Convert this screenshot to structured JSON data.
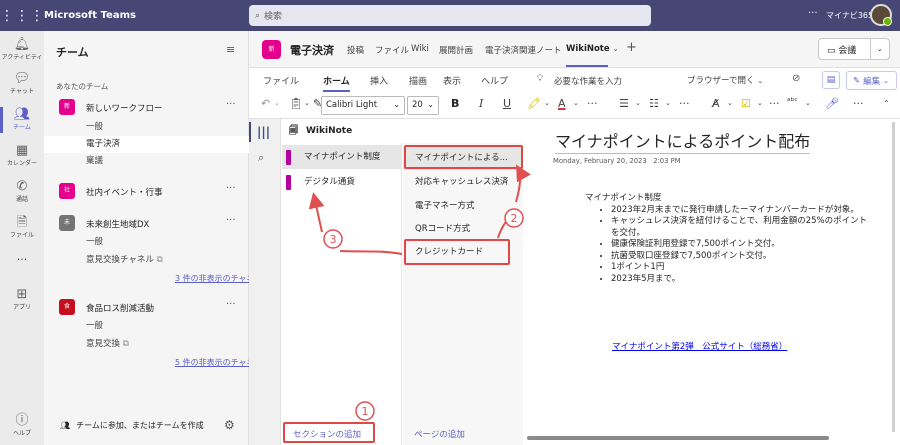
{
  "topbar": {
    "app_name": "Microsoft Teams",
    "search_placeholder": "検索",
    "more": "···",
    "org": "マイナビ365"
  },
  "rail": [
    {
      "label": "アクティビティ",
      "icon": "bell-icon"
    },
    {
      "label": "チャット",
      "icon": "chat-icon"
    },
    {
      "label": "チーム",
      "icon": "teams-icon"
    },
    {
      "label": "カレンダー",
      "icon": "calendar-icon"
    },
    {
      "label": "通話",
      "icon": "phone-icon"
    },
    {
      "label": "ファイル",
      "icon": "file-icon"
    },
    {
      "label": "···",
      "icon": "more-icon"
    },
    {
      "label": "アプリ",
      "icon": "apps-icon"
    },
    {
      "label": "ヘルプ",
      "icon": "help-icon"
    }
  ],
  "teams_panel": {
    "title": "チーム",
    "section": "あなたのチーム",
    "teams": [
      {
        "icon": "新",
        "color": "#e3008c",
        "name": "新しいワークフロー",
        "channels": [
          "一般",
          "電子決済",
          "稟議"
        ]
      },
      {
        "icon": "社",
        "color": "#e3008c",
        "name": "社内イベント・行事",
        "channels": []
      },
      {
        "icon": "未",
        "color": "#757575",
        "name": "未来創生地域DX",
        "channels": [
          "一般",
          "意見交換チャネル"
        ],
        "hidden": "3 件の非表示のチャネル"
      },
      {
        "icon": "食",
        "color": "#c50f1f",
        "name": "食品ロス削減活動",
        "channels": [
          "一般",
          "意見交換"
        ],
        "hidden": "5 件の非表示のチャネル"
      }
    ],
    "join": "チームに参加、またはチームを作成"
  },
  "channel_header": {
    "icon": "新",
    "name": "電子決済",
    "tabs": [
      "投稿",
      "ファイル",
      "Wiki",
      "展開計画",
      "電子決済関連ノート",
      "WikiNote"
    ],
    "meeting": "会議"
  },
  "ribbon": {
    "tabs": [
      "ファイル",
      "ホーム",
      "挿入",
      "描画",
      "表示",
      "ヘルプ"
    ],
    "tell_me": "必要な作業を入力",
    "browser": "ブラウザーで開く",
    "edit": "編集"
  },
  "toolbar": {
    "font": "Calibri Light",
    "size": "20"
  },
  "notebook": {
    "title": "WikiNote",
    "sections": [
      {
        "name": "マイナポイント制度",
        "color": "#b4009e"
      },
      {
        "name": "デジタル通貨",
        "color": "#b4009e"
      }
    ],
    "pages": [
      "マイナポイントによる...",
      "対応キャッシュレス決済",
      "電子マネー方式",
      "QRコード方式",
      "クレジットカード"
    ],
    "add_section": "セクションの追加",
    "add_page": "ページの追加"
  },
  "page": {
    "title": "マイナポイントによるポイント配布",
    "date": "Monday, February 20, 2023",
    "time": "2:03 PM",
    "heading": "マイナポイント制度",
    "bullets": [
      "2023年2月末までに発行申請したーマイナンバーカードが対象。",
      "キャッシュレス決済を紐付けることで、利用金額の25%のポイントを交付。",
      "健康保険証利用登録で7,500ポイント交付。",
      "抗菌受取口座登録で7,500ポイント交付。",
      "1ポイント1円",
      "2023年5月まで。"
    ],
    "link": "マイナポイント第2弾　公式サイト（総務省）"
  },
  "annotations": [
    "1",
    "2",
    "3"
  ]
}
